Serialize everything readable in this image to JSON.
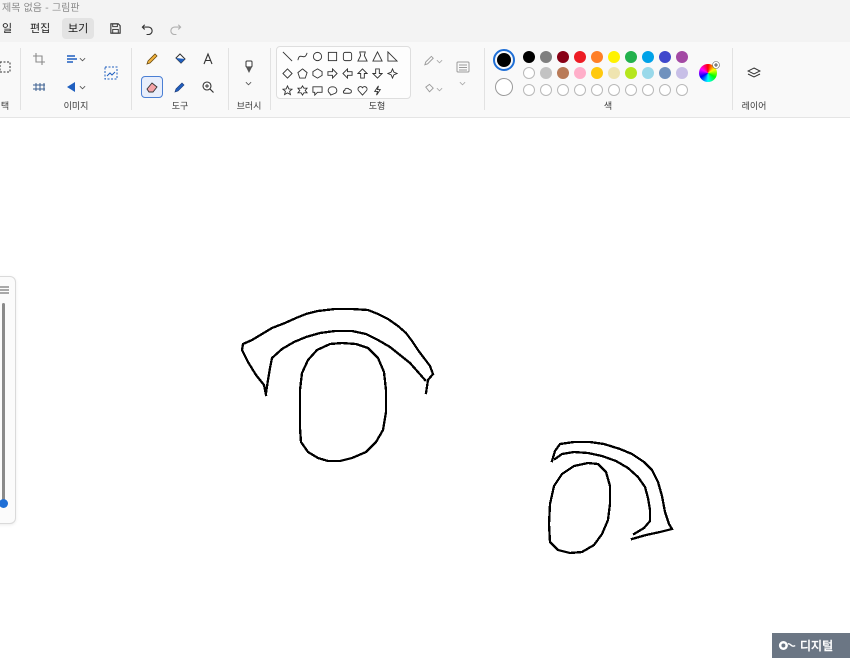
{
  "window": {
    "title": "제목 없음 - 그림판"
  },
  "menu": {
    "file_label": "일",
    "edit_label": "편집",
    "view_label": "보기"
  },
  "ribbon": {
    "groups": {
      "selection_label": "택",
      "image_label": "이미지",
      "tools_label": "도구",
      "brush_label": "브러시",
      "shapes_label": "도형",
      "colors_label": "색",
      "layers_label": "레이어"
    },
    "selected_tool": "eraser",
    "primary_color": "#000000",
    "secondary_color": "#ffffff",
    "palette_row1": [
      "#000000",
      "#7f7f7f",
      "#880015",
      "#ed1c24",
      "#ff7f27",
      "#fff200",
      "#22b14c",
      "#00a2e8",
      "#3f48cc",
      "#a349a4"
    ],
    "palette_row2": [
      "#ffffff",
      "#c3c3c3",
      "#b97a57",
      "#ffaec9",
      "#ffc90e",
      "#efe4b0",
      "#b5e61d",
      "#99d9ea",
      "#7092be",
      "#c8bfe7"
    ],
    "custom_colors_count": 10
  },
  "watermark": {
    "text": "디지털"
  }
}
